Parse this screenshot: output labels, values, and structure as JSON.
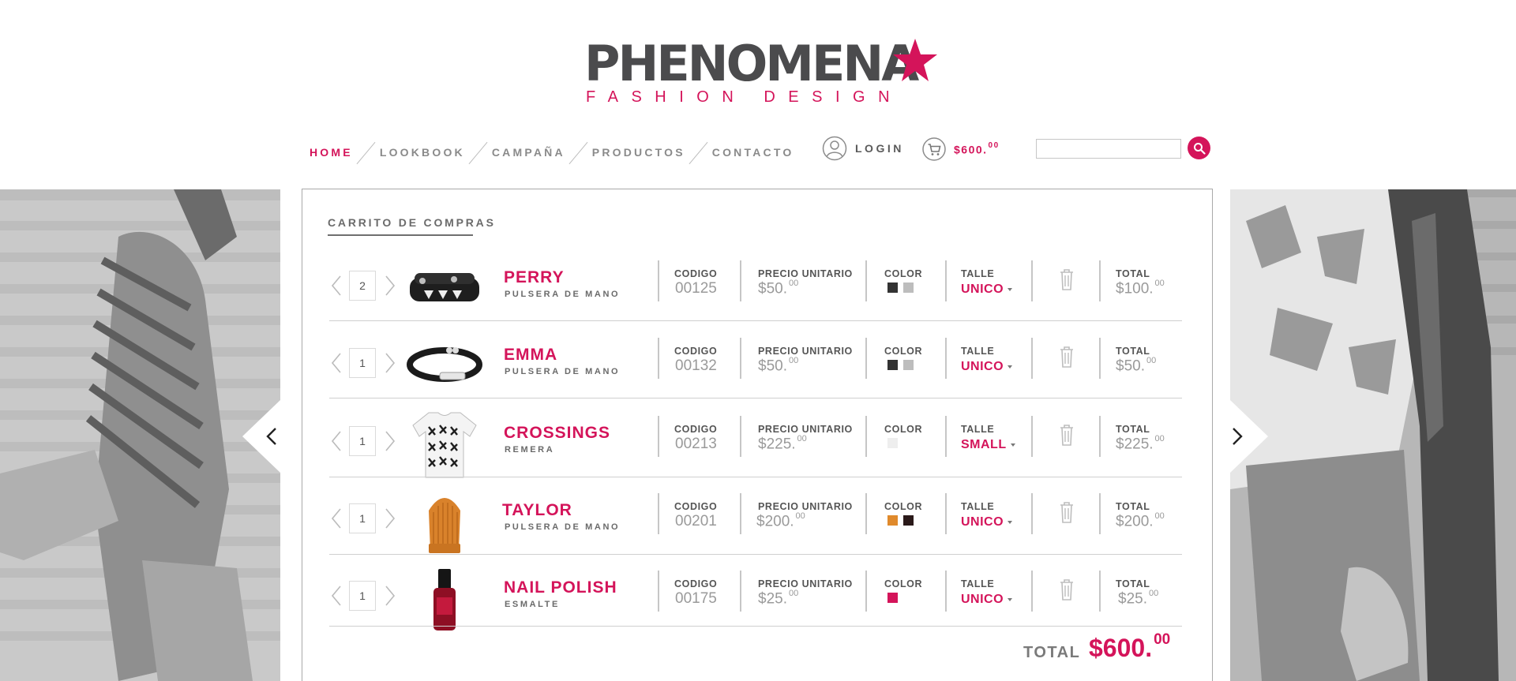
{
  "brand": {
    "name": "PHENOMENA",
    "tagline": "FASHION DESIGN",
    "accent_color": "#d4145a",
    "logo_icon": "star-icon"
  },
  "nav": {
    "items": [
      {
        "label": "HOME",
        "active": true
      },
      {
        "label": "LOOKBOOK",
        "active": false
      },
      {
        "label": "CAMPAÑA",
        "active": false
      },
      {
        "label": "PRODUCTOS",
        "active": false
      },
      {
        "label": "CONTACTO",
        "active": false
      }
    ]
  },
  "user": {
    "login_label": "LOGIN",
    "cart_amount": "$600.",
    "cart_cents": "00"
  },
  "search": {
    "value": "",
    "icon": "search-icon"
  },
  "cart": {
    "title": "CARRITO DE COMPRAS",
    "labels": {
      "code": "CODIGO",
      "unit_price": "PRECIO UNITARIO",
      "color": "COLOR",
      "size": "TALLE",
      "total": "TOTAL"
    },
    "items": [
      {
        "qty": "2",
        "name": "PERRY",
        "desc": "PULSERA DE MANO",
        "code": "00125",
        "price": "$50.",
        "price_cents": "00",
        "colors": [
          "#333333",
          "#bdbdbd"
        ],
        "size": "UNICO",
        "total": "$100.",
        "total_cents": "00",
        "image": "bracelet-studded"
      },
      {
        "qty": "1",
        "name": "EMMA",
        "desc": "PULSERA DE MANO",
        "code": "00132",
        "price": "$50.",
        "price_cents": "00",
        "colors": [
          "#333333",
          "#bdbdbd"
        ],
        "size": "UNICO",
        "total": "$50.",
        "total_cents": "00",
        "image": "bracelet-cord"
      },
      {
        "qty": "1",
        "name": "CROSSINGS",
        "desc": "REMERA",
        "code": "00213",
        "price": "$225.",
        "price_cents": "00",
        "colors": [
          "#eeeeee"
        ],
        "size": "SMALL",
        "total": "$225.",
        "total_cents": "00",
        "image": "tshirt-pattern"
      },
      {
        "qty": "1",
        "name": "TAYLOR",
        "desc": "PULSERA DE MANO",
        "code": "00201",
        "price": "$200.",
        "price_cents": "00",
        "colors": [
          "#e08a2c",
          "#2b1a1a"
        ],
        "size": "UNICO",
        "total": "$200.",
        "total_cents": "00",
        "image": "beanie-orange"
      },
      {
        "qty": "1",
        "name": "NAIL POLISH",
        "desc": "ESMALTE",
        "code": "00175",
        "price": "$25.",
        "price_cents": "00",
        "colors": [
          "#d4145a"
        ],
        "size": "UNICO",
        "total": "$25.",
        "total_cents": "00",
        "image": "nail-polish"
      }
    ],
    "grand_total_label": "TOTAL",
    "grand_total": "$600.",
    "grand_total_cents": "00"
  }
}
